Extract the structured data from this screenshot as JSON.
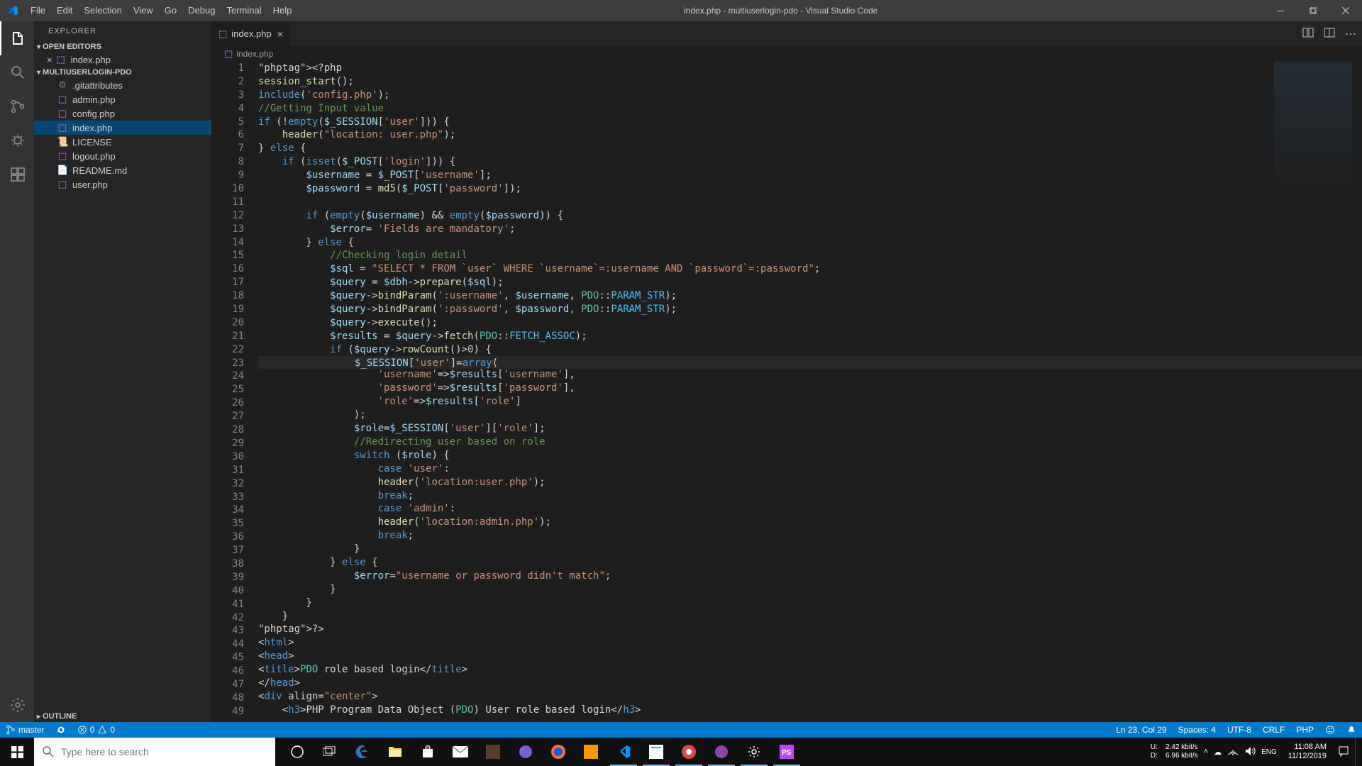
{
  "window": {
    "title": "index.php - multiuserlogin-pdo - Visual Studio Code"
  },
  "menu": [
    "File",
    "Edit",
    "Selection",
    "View",
    "Go",
    "Debug",
    "Terminal",
    "Help"
  ],
  "sidebar": {
    "title": "Explorer",
    "sections": {
      "open_editors": "Open Editors",
      "project": "multiuserlogin-pdo",
      "outline": "Outline"
    },
    "open_editor_item": "index.php",
    "files": [
      ".gitattributes",
      "admin.php",
      "config.php",
      "index.php",
      "LICENSE",
      "logout.php",
      "README.md",
      "user.php"
    ]
  },
  "tab": {
    "label": "index.php"
  },
  "breadcrumb": {
    "label": "index.php"
  },
  "code_lines": [
    "<?php",
    "session_start();",
    "include('config.php');",
    "//Getting Input value",
    "if (!empty($_SESSION['user'])) {",
    "    header(\"location: user.php\");",
    "} else {",
    "    if (isset($_POST['login'])) {",
    "        $username = $_POST['username'];",
    "        $password = md5($_POST['password']);",
    "",
    "        if (empty($username) && empty($password)) {",
    "            $error= 'Fields are mandatory';",
    "        } else {",
    "            //Checking login detail",
    "            $sql = \"SELECT * FROM `user` WHERE `username`=:username AND `password`=:password\";",
    "            $query = $dbh->prepare($sql);",
    "            $query->bindParam(':username', $username, PDO::PARAM_STR);",
    "            $query->bindParam(':password', $password, PDO::PARAM_STR);",
    "            $query->execute();",
    "            $results = $query->fetch(PDO::FETCH_ASSOC);",
    "            if ($query->rowCount()>0) {",
    "                $_SESSION['user']=array(",
    "                    'username'=>$results['username'],",
    "                    'password'=>$results['password'],",
    "                    'role'=>$results['role']",
    "                );",
    "                $role=$_SESSION['user']['role'];",
    "                //Redirecting user based on role",
    "                switch ($role) {",
    "                    case 'user':",
    "                    header('location:user.php');",
    "                    break;",
    "                    case 'admin':",
    "                    header('location:admin.php');",
    "                    break;",
    "                }",
    "            } else {",
    "                $error=\"username or password didn't match\";",
    "            }",
    "        }",
    "    }",
    "?>",
    "<html>",
    "<head>",
    "<title>PDO role based login</title>",
    "</head>",
    "<div align=\"center\">",
    "    <h3>PHP Program Data Object (PDO) User role based login</h3>"
  ],
  "status": {
    "branch": "master",
    "sync": "",
    "errors": "0",
    "warnings": "0",
    "position": "Ln 23, Col 29",
    "spaces": "Spaces: 4",
    "encoding": "UTF-8",
    "eol": "CRLF",
    "lang": "PHP",
    "feedback": ""
  },
  "taskbar": {
    "search_placeholder": "Type here to search",
    "net_up": "2.42 kbit/s",
    "net_down": "6.96 kbit/s",
    "net_up_label": "U:",
    "net_down_label": "D:",
    "time": "11:08 AM",
    "date": "11/12/2019"
  }
}
